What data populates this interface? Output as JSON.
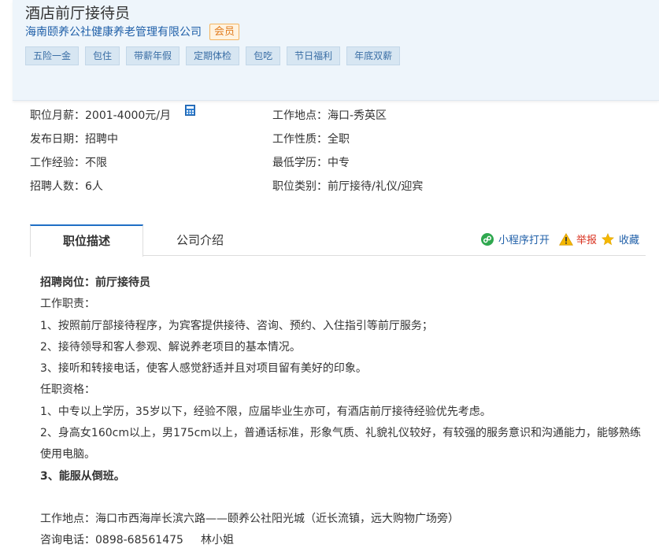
{
  "header": {
    "job_title": "酒店前厅接待员",
    "company": "海南颐养公社健康养老管理有限公司",
    "member_badge": "会员",
    "tags": [
      "五险一金",
      "包住",
      "带薪年假",
      "定期体检",
      "包吃",
      "节日福利",
      "年底双薪"
    ]
  },
  "info": {
    "salary_label": "职位月薪：",
    "salary_value": "2001-4000元/月",
    "location_label": "工作地点：",
    "location_value": "海口-秀英区",
    "publish_label": "发布日期：",
    "publish_value": "招聘中",
    "nature_label": "工作性质：",
    "nature_value": "全职",
    "experience_label": "工作经验：",
    "experience_value": "不限",
    "education_label": "最低学历：",
    "education_value": "中专",
    "headcount_label": "招聘人数：",
    "headcount_value": "6人",
    "category_label": "职位类别：",
    "category_value": "前厅接待/礼仪/迎宾"
  },
  "tabs": {
    "description": "职位描述",
    "company_intro": "公司介绍"
  },
  "actions": {
    "mini_program": "小程序打开",
    "report": "举报",
    "favorite": "收藏"
  },
  "description": {
    "post": "招聘岗位：前厅接待员",
    "duties_title": "工作职责：",
    "duty1": "1、按照前厅部接待程序，为宾客提供接待、咨询、预约、入住指引等前厅服务；",
    "duty2": "2、接待领导和客人参观、解说养老项目的基本情况。",
    "duty3": "3、接听和转接电话，使客人感觉舒适并且对项目留有美好的印象。",
    "qual_title": "任职资格：",
    "qual1": "1、中专以上学历，35岁以下，经验不限，应届毕业生亦可，有酒店前厅接待经验优先考虑。",
    "qual2": "2、身高女160cm以上，男175cm以上，普通话标准，形象气质、礼貌礼仪较好，有较强的服务意识和沟通能力，能够熟练使用电脑。",
    "qual3": "3、能服从倒班。",
    "address": "工作地点：海口市西海岸长滨六路——颐养公社阳光城（近长流镇，远大购物广场旁）",
    "phone": "咨询电话：0898-68561475",
    "contact": "林小姐"
  },
  "colors": {
    "header_bg": "#eef5fb",
    "link_blue": "#1f5fa8",
    "tag_bg": "#d7e6f2",
    "tab_active_border": "#1f6fc5",
    "report_red": "#d9311f",
    "badge_orange": "#e07b1e"
  },
  "icons": {
    "calculator": "calculator-icon",
    "mini_program": "mini-program-icon",
    "report": "warning-icon",
    "favorite": "star-icon"
  }
}
